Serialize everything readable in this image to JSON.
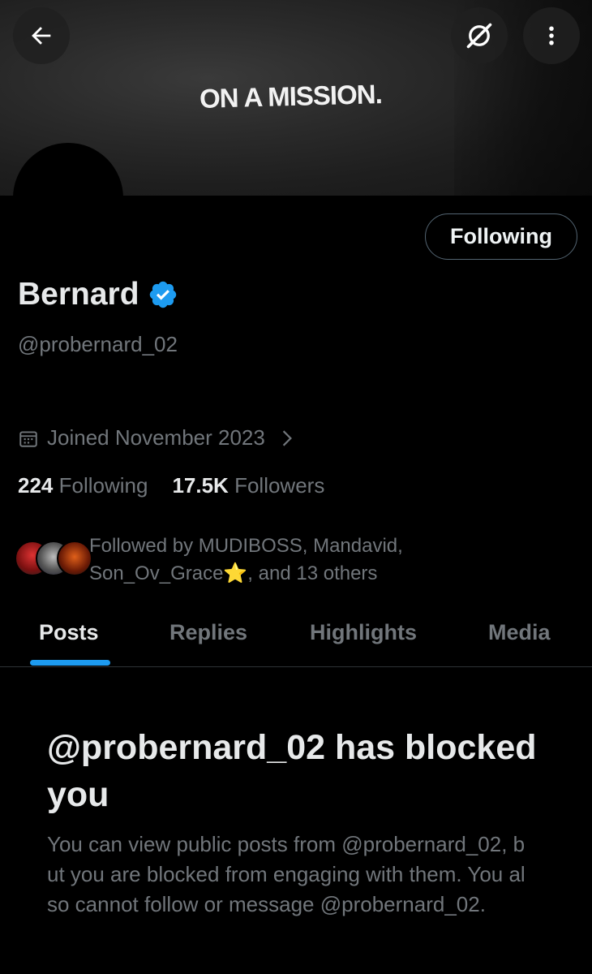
{
  "header": {
    "banner_text": "ON A MISSION.",
    "back_icon": "arrow-left-icon",
    "grok_icon": "grok-icon",
    "more_icon": "more-vertical-icon"
  },
  "profile": {
    "follow_button_label": "Following",
    "display_name": "Bernard",
    "verified_icon": "verified-badge-icon",
    "verified_color": "#1d9bf0",
    "handle": "@probernard_02",
    "joined": "Joined November 2023",
    "following_count": "224",
    "following_label": "Following",
    "followers_count": "17.5K",
    "followers_label": "Followers",
    "followed_by_line1": "Followed by MUDIBOSS, Mandavid,",
    "followed_by_line2": "Son_Ov_Grace⭐, and 13 others"
  },
  "tabs": [
    {
      "label": "Posts",
      "active": true
    },
    {
      "label": "Replies",
      "active": false
    },
    {
      "label": "Highlights",
      "active": false
    },
    {
      "label": "Media",
      "active": false
    }
  ],
  "blocked": {
    "title": "@probernard_02 has blocked you",
    "message": "You can view public posts from @probernard_02, but you are blocked from engaging with them. You also cannot follow or message @probernard_02."
  },
  "colors": {
    "background": "#000000",
    "accent": "#1d9bf0",
    "secondary_text": "#71767b"
  }
}
